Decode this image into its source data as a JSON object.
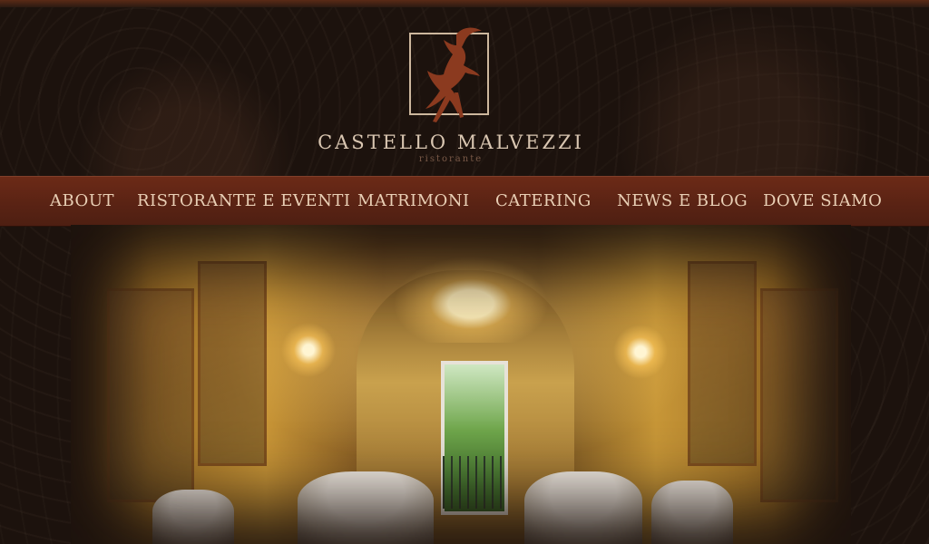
{
  "brand": {
    "name": "CASTELLO MALVEZZI",
    "subtitle": "ristorante",
    "logo_icon": "leaping-goat-icon",
    "colors": {
      "logo": "#8b3a1f",
      "frame": "#cdb79d",
      "nav_bg": "#5a2314",
      "nav_text": "#e9cfb5",
      "page_bg": "#1c120d"
    }
  },
  "nav": {
    "items": [
      {
        "label": "ABOUT"
      },
      {
        "label": "RISTORANTE E EVENTI"
      },
      {
        "label": "MATRIMONI"
      },
      {
        "label": "CATERING"
      },
      {
        "label": "NEWS E BLOG"
      },
      {
        "label": "DOVE SIAMO"
      }
    ]
  },
  "hero": {
    "image": "frescoed-dining-hall-with-chandelier"
  }
}
